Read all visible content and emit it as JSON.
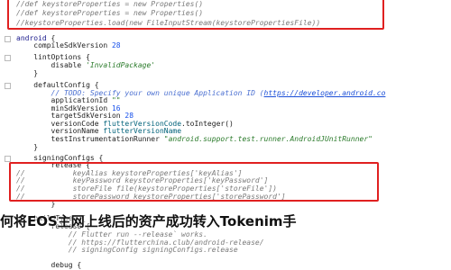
{
  "lines": [
    {
      "t": 0,
      "indent": "",
      "parts": [
        [
          "cm",
          "//def keystoreProperties = new Properties()"
        ]
      ]
    },
    {
      "t": 10,
      "indent": "",
      "parts": [
        [
          "cm",
          "//def keystoreProperties = new Properties()"
        ]
      ]
    },
    {
      "t": 21,
      "indent": "",
      "parts": [
        [
          "cm",
          "//keystoreProperties.load(new FileInputStream(keystorePropertiesFile))"
        ]
      ]
    },
    {
      "t": 38,
      "indent": "",
      "parts": [
        [
          "kw",
          "android"
        ],
        [
          "",
          " {"
        ]
      ],
      "fold": true
    },
    {
      "t": 46,
      "indent": "    ",
      "parts": [
        [
          "",
          "compileSdkVersion "
        ],
        [
          "num",
          "28"
        ]
      ]
    },
    {
      "t": 59,
      "indent": "    ",
      "parts": [
        [
          "",
          "lintOptions {"
        ]
      ],
      "fold": true
    },
    {
      "t": 68,
      "indent": "        ",
      "parts": [
        [
          "",
          "disable "
        ],
        [
          "str",
          "'InvalidPackage'"
        ]
      ]
    },
    {
      "t": 77,
      "indent": "    ",
      "parts": [
        [
          "",
          "}"
        ]
      ]
    },
    {
      "t": 90,
      "indent": "    ",
      "parts": [
        [
          "",
          "defaultConfig {"
        ]
      ],
      "fold": true
    },
    {
      "t": 99,
      "indent": "        ",
      "parts": [
        [
          "todo",
          "// TODO: Specify your own unique Application ID ("
        ],
        [
          "link",
          "https://developer.android.co"
        ]
      ]
    },
    {
      "t": 107,
      "indent": "        ",
      "parts": [
        [
          "",
          "applicationId "
        ],
        [
          "str",
          "\"\""
        ]
      ]
    },
    {
      "t": 116,
      "indent": "        ",
      "parts": [
        [
          "",
          "minSdkVersion "
        ],
        [
          "num",
          "16"
        ]
      ]
    },
    {
      "t": 124,
      "indent": "        ",
      "parts": [
        [
          "",
          "targetSdkVersion "
        ],
        [
          "num",
          "28"
        ]
      ]
    },
    {
      "t": 133,
      "indent": "        ",
      "parts": [
        [
          "",
          "versionCode "
        ],
        [
          "fn",
          "flutterVersionCode"
        ],
        [
          "",
          ".toInteger()"
        ]
      ]
    },
    {
      "t": 141,
      "indent": "        ",
      "parts": [
        [
          "",
          "versionName "
        ],
        [
          "fn",
          "flutterVersionName"
        ]
      ]
    },
    {
      "t": 150,
      "indent": "        ",
      "parts": [
        [
          "",
          "testInstrumentationRunner "
        ],
        [
          "str",
          "\"android.support.test.runner.AndroidJUnitRunner\""
        ]
      ]
    },
    {
      "t": 159,
      "indent": "    ",
      "parts": [
        [
          "",
          "}"
        ]
      ]
    },
    {
      "t": 171,
      "indent": "    ",
      "parts": [
        [
          "",
          "signingConfigs {"
        ]
      ],
      "fold": true
    },
    {
      "t": 179,
      "indent": "        ",
      "parts": [
        [
          "",
          "release {"
        ]
      ]
    },
    {
      "t": 188,
      "indent": "",
      "parts": [
        [
          "cm",
          "//           keyAlias keystoreProperties['keyAlias']"
        ]
      ]
    },
    {
      "t": 196,
      "indent": "",
      "parts": [
        [
          "cm",
          "//           keyPassword keystoreProperties['keyPassword']"
        ]
      ]
    },
    {
      "t": 205,
      "indent": "",
      "parts": [
        [
          "cm",
          "//           storeFile file(keystoreProperties['storeFile'])"
        ]
      ]
    },
    {
      "t": 214,
      "indent": "",
      "parts": [
        [
          "cm",
          "//           storePassword keystoreProperties['storePassword']"
        ]
      ]
    },
    {
      "t": 222,
      "indent": "        ",
      "parts": [
        [
          "",
          "}"
        ]
      ]
    },
    {
      "t": 238,
      "indent": "    ",
      "parts": [
        [
          "",
          "buildTypes {"
        ]
      ],
      "fold": true
    },
    {
      "t": 247,
      "indent": "        ",
      "parts": [
        [
          "",
          "release {"
        ]
      ]
    },
    {
      "t": 256,
      "indent": "            ",
      "parts": [
        [
          "cm",
          "// Flutter run --release` works."
        ]
      ]
    },
    {
      "t": 265,
      "indent": "            ",
      "parts": [
        [
          "cm",
          "// https://flutterchina.club/android-release/"
        ]
      ]
    },
    {
      "t": 273,
      "indent": "            ",
      "parts": [
        [
          "cm",
          "// signingConfig signingConfigs.release"
        ]
      ]
    },
    {
      "t": 290,
      "indent": "        ",
      "parts": [
        [
          "",
          "debug {"
        ]
      ]
    }
  ],
  "overlay_title": "何将EOS主网上线后的资产成功转入Tokenim手"
}
